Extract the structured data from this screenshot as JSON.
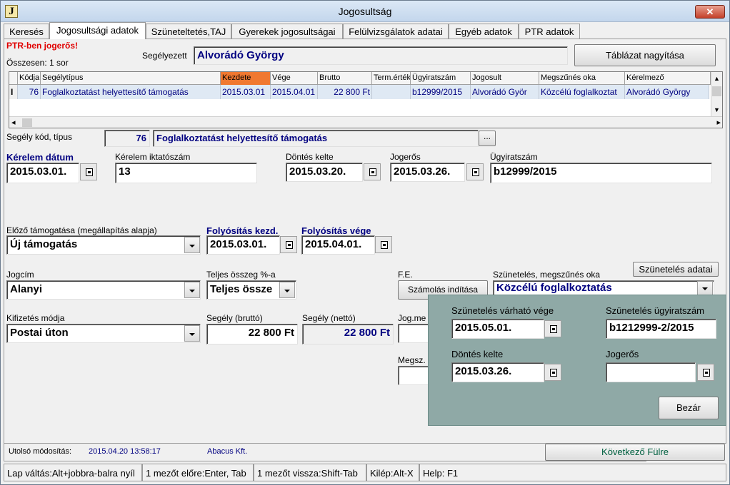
{
  "window": {
    "title": "Jogosultság",
    "close": "✕"
  },
  "tabs": [
    "Keresés",
    "Jogosultsági adatok",
    "Szüneteltetés,TAJ",
    "Gyerekek jogosultságai",
    "Felülvizsgálatok adatai",
    "Egyéb adatok",
    "PTR adatok"
  ],
  "header": {
    "ptr_warning": "PTR-ben jogerős!",
    "total": "Összesen: 1 sor",
    "segelyezett_label": "Segélyezett",
    "segelyezett_value": "Alvorádó György",
    "enlarge_button": "Táblázat nagyítása"
  },
  "grid": {
    "columns": [
      "Kódja",
      "Segélytípus",
      "Kezdete",
      "Vége",
      "Brutto",
      "Term.érték",
      "Ügyiratszám",
      "Jogosult",
      "Megszűnés oka",
      "Kérelmező"
    ],
    "row": [
      "76",
      "Foglalkoztatást helyettesítő támogatás",
      "2015.03.01",
      "2015.04.01",
      "22 800 Ft",
      "",
      "b12999/2015",
      "Alvorádó Györ",
      "Közcélú foglalkoztat",
      "Alvorádó György"
    ],
    "row_marker": "I",
    "highlight_color": "#f07830"
  },
  "form": {
    "segely_kod_label": "Segély kód, típus",
    "segely_kod": "76",
    "segely_tipus": "Foglalkoztatást helyettesítő támogatás",
    "ellipsis": "...",
    "kerelem_datum_label": "Kérelem dátum",
    "kerelem_datum": "2015.03.01.",
    "kerelem_iktato_label": "Kérelem iktatószám",
    "kerelem_iktato": "13",
    "dontes_kelte_label": "Döntés kelte",
    "dontes_kelte": "2015.03.20.",
    "jogeros_label": "Jogerős",
    "jogeros": "2015.03.26.",
    "ugyiratszam_label": "Ügyiratszám",
    "ugyiratszam": "b12999/2015",
    "elozo_label": "Előző támogatása (megállapítás alapja)",
    "elozo": "Új támogatás",
    "foly_kezd_label": "Folyósítás kezd.",
    "foly_kezd": "2015.03.01.",
    "foly_vege_label": "Folyósítás vége",
    "foly_vege": "2015.04.01.",
    "jogcim_label": "Jogcím",
    "jogcim": "Alanyi",
    "teljes_label": "Teljes összeg %-a",
    "teljes": "Teljes össze",
    "fe_label": "F.E.",
    "szamolas_button": "Számolás indítása",
    "szunetelés_oka_label": "Szünetelés, megszűnés oka",
    "szunetelés_oka": "Közcélú foglalkoztatás",
    "szunetelés_adatai_button": "Szünetelés adatai",
    "kifizetes_label": "Kifizetés módja",
    "kifizetes": "Postai úton",
    "brutto_label": "Segély (bruttó)",
    "brutto": "22 800 Ft",
    "netto_label": "Segély (nettó)",
    "netto": "22 800 Ft",
    "jog_me_label": "Jog.me",
    "megsz_label": "Megsz."
  },
  "popup": {
    "varhato_vege_label": "Szünetelés várható vége",
    "varhato_vege": "2015.05.01.",
    "ugyiratszam_label": "Szünetelés ügyiratszám",
    "ugyiratszam": "b1212999-2/2015",
    "dontes_kelte_label": "Döntés kelte",
    "dontes_kelte": "2015.03.26.",
    "jogeros_label": "Jogerős",
    "jogeros": "",
    "close_button": "Bezár"
  },
  "footer": {
    "last_mod_label": "Utolsó módosítás:",
    "last_mod_time": "2015.04.20 13:58:17",
    "last_mod_user": "Abacus Kft.",
    "next_button": "Következő Fülre"
  },
  "statusbar": [
    "Lap váltás:Alt+jobbra-balra nyíl",
    "1 mezőt előre:Enter, Tab",
    "1 mezőt vissza:Shift-Tab",
    "Kilép:Alt-X",
    "Help: F1"
  ]
}
